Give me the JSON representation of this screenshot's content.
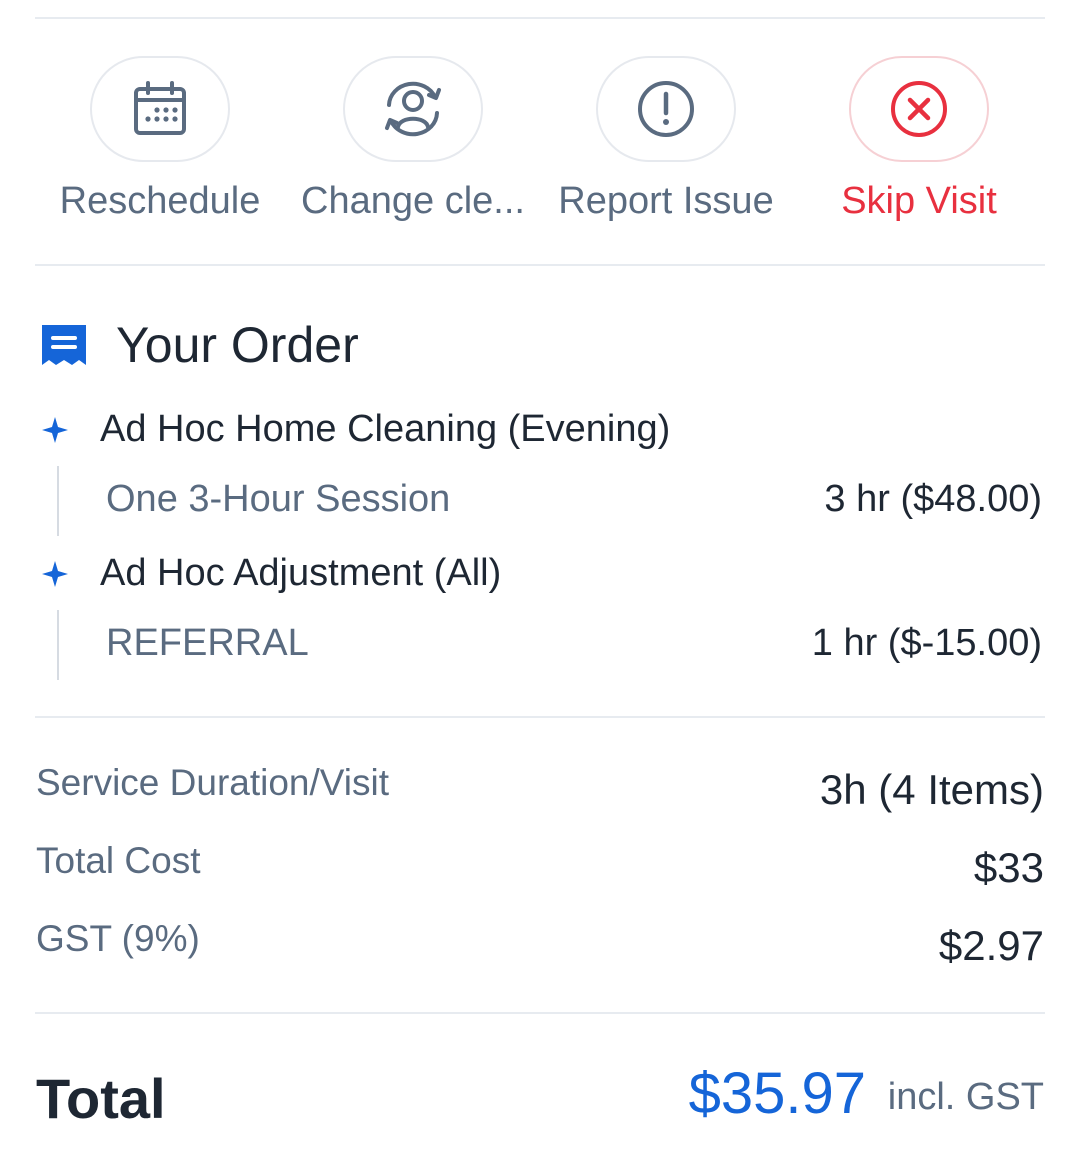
{
  "actions": [
    {
      "label": "Reschedule",
      "icon": "calendar-icon"
    },
    {
      "label": "Change cle...",
      "icon": "change-cleaner-icon"
    },
    {
      "label": "Report Issue",
      "icon": "exclamation-circle-icon"
    },
    {
      "label": "Skip Visit",
      "icon": "x-circle-icon",
      "color": "#e8303f"
    }
  ],
  "order": {
    "title": "Your Order",
    "icon": "receipt-icon",
    "items": [
      {
        "name": "Ad Hoc Home Cleaning (Evening)",
        "sub_name": "One 3-Hour Session",
        "sub_value": "3 hr ($48.00)"
      },
      {
        "name": "Ad Hoc Adjustment (All)",
        "sub_name": "REFERRAL",
        "sub_value": "1 hr ($-15.00)"
      }
    ]
  },
  "summary": {
    "duration_label": "Service Duration/Visit",
    "duration_value": "3h (4 Items)",
    "total_cost_label": "Total Cost",
    "total_cost_value": "$33",
    "gst_label": "GST (9%)",
    "gst_value": "$2.97"
  },
  "total": {
    "label": "Total",
    "amount": "$35.97",
    "note": "incl. GST"
  },
  "colors": {
    "accent": "#1565d8",
    "danger": "#e8303f",
    "text": "#1e2733",
    "muted": "#5a6b80"
  }
}
